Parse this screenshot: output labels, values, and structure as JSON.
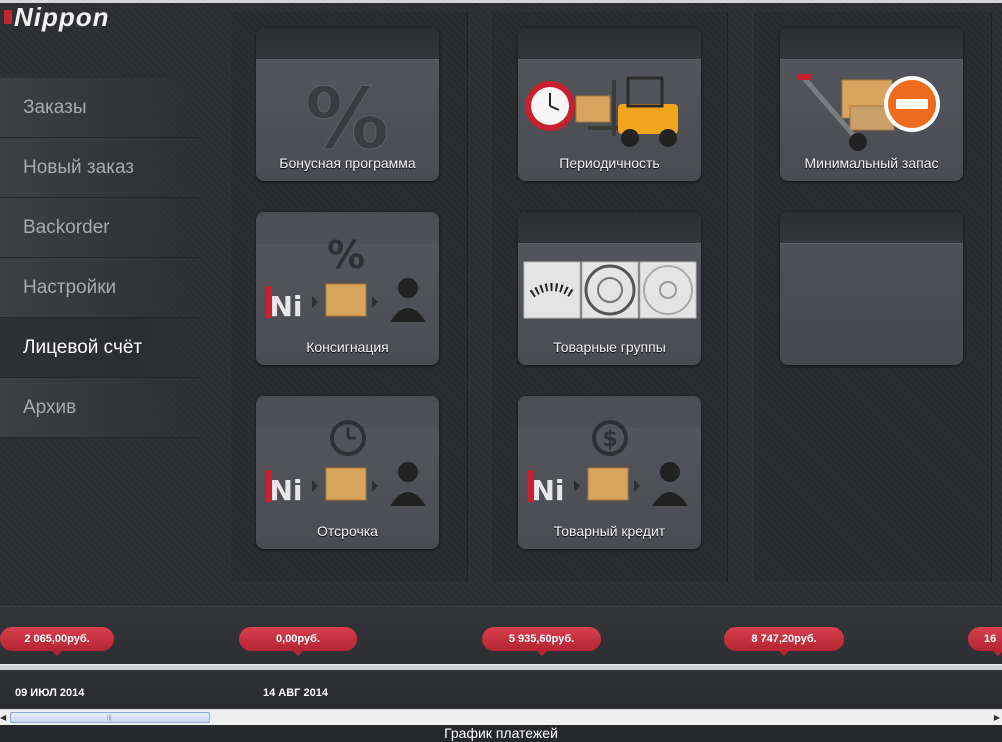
{
  "app": {
    "logo_text": "Nippon"
  },
  "sidebar": {
    "items": [
      {
        "label": "Заказы"
      },
      {
        "label": "Новый заказ"
      },
      {
        "label": "Backorder"
      },
      {
        "label": "Настройки"
      },
      {
        "label": "Лицевой счёт",
        "active": true
      },
      {
        "label": "Архив"
      }
    ]
  },
  "tiles": {
    "bonus": {
      "label": "Бонусная программа",
      "icon": "percent-icon"
    },
    "periodicity": {
      "label": "Периодичность",
      "icon": "forklift-clock-icon"
    },
    "min_stock": {
      "label": "Минимальный запас",
      "icon": "trolley-minus-icon"
    },
    "consignment": {
      "label": "Консигнация",
      "icon": "consignment-flow-icon"
    },
    "product_groups": {
      "label": "Товарные группы",
      "icon": "brake-parts-icon"
    },
    "deferral": {
      "label": "Отсрочка",
      "icon": "clock-flow-icon"
    },
    "credit": {
      "label": "Товарный кредит",
      "icon": "dollar-flow-icon"
    }
  },
  "timeline": {
    "amounts": [
      "2 065,00руб.",
      "0,00руб.",
      "5 935,60руб.",
      "8 747,20руб.",
      "16"
    ],
    "dates": [
      "09 ИЮЛ 2014",
      "14 АВГ 2014"
    ],
    "title": "График платежей"
  },
  "colors": {
    "accent_red": "#c0262f",
    "tile_bg": "#4f5256",
    "page_bg": "#2c2e31"
  }
}
